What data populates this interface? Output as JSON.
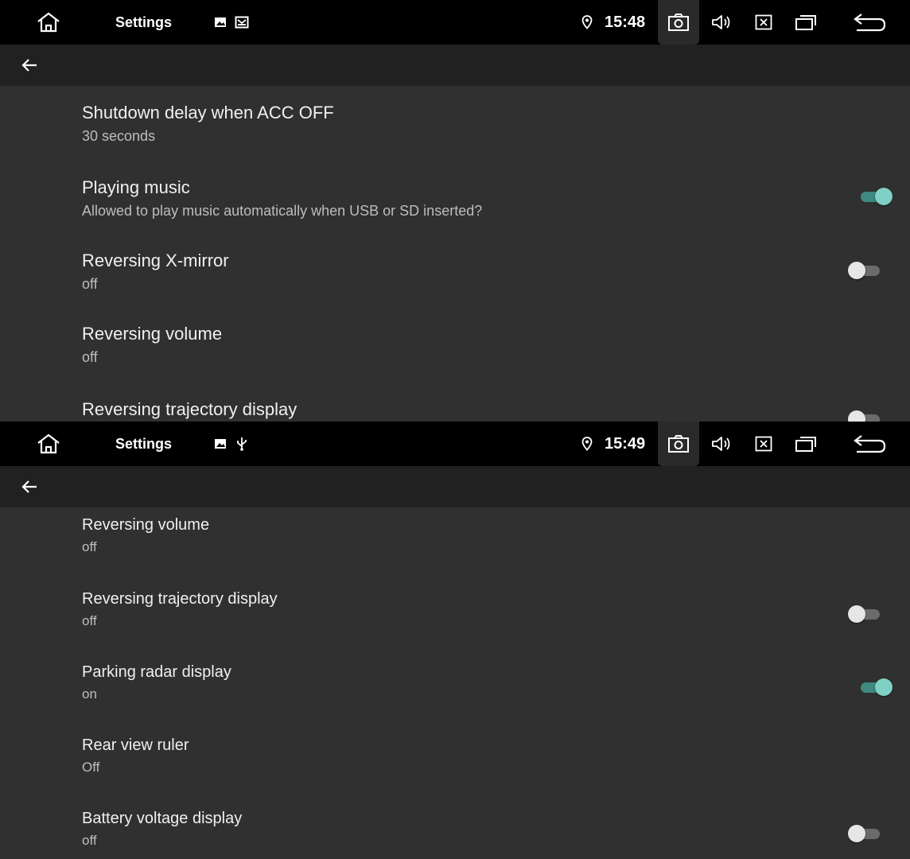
{
  "top_screen": {
    "status": {
      "title": "Settings",
      "time": "15:48",
      "icons": [
        "home-icon",
        "image-icon",
        "mail-icon",
        "location-icon",
        "camera-icon",
        "volume-icon",
        "close-box-icon",
        "recent-apps-icon",
        "back-icon"
      ]
    },
    "items": [
      {
        "title": "Shutdown delay when ACC OFF",
        "summary": "30 seconds"
      },
      {
        "title": "Playing music",
        "summary": "Allowed to play music automatically when USB or SD inserted?",
        "toggle": "on"
      },
      {
        "title": "Reversing X-mirror",
        "summary": "off",
        "toggle": "off"
      },
      {
        "title": "Reversing volume",
        "summary": "off"
      },
      {
        "title": "Reversing trajectory display",
        "toggle": "off"
      }
    ]
  },
  "bottom_screen": {
    "status": {
      "title": "Settings",
      "time": "15:49",
      "icons": [
        "home-icon",
        "image-icon",
        "usb-icon",
        "location-icon",
        "camera-icon",
        "volume-icon",
        "close-box-icon",
        "recent-apps-icon",
        "back-icon"
      ]
    },
    "items": [
      {
        "title": "Reversing volume",
        "summary": "off"
      },
      {
        "title": "Reversing trajectory display",
        "summary": "off",
        "toggle": "off"
      },
      {
        "title": "Parking radar display",
        "summary": "on",
        "toggle": "on"
      },
      {
        "title": "Rear view ruler",
        "summary": "Off"
      },
      {
        "title": "Battery voltage display",
        "summary": "off",
        "toggle": "off"
      }
    ]
  },
  "colors": {
    "background": "#303030",
    "appbar": "#212121",
    "statusbar": "#000000",
    "accent": "#7fd1c5"
  }
}
